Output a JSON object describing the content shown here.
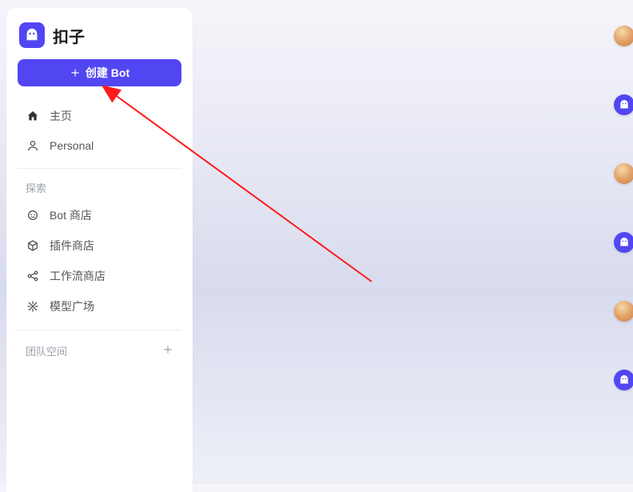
{
  "brand": {
    "title": "扣子"
  },
  "create_button": {
    "label": "创建 Bot"
  },
  "nav": {
    "home": "主页",
    "personal": "Personal"
  },
  "explore": {
    "header": "探索",
    "bot_store": "Bot 商店",
    "plugin_store": "插件商店",
    "workflow_store": "工作流商店",
    "model_plaza": "模型广场"
  },
  "team": {
    "header": "团队空间"
  },
  "annotation": {
    "type": "arrow",
    "color": "#ff1a1a"
  },
  "side_items": [
    {
      "type": "photo"
    },
    {
      "type": "bot"
    },
    {
      "type": "photo"
    },
    {
      "type": "bot"
    },
    {
      "type": "photo"
    },
    {
      "type": "bot"
    }
  ]
}
